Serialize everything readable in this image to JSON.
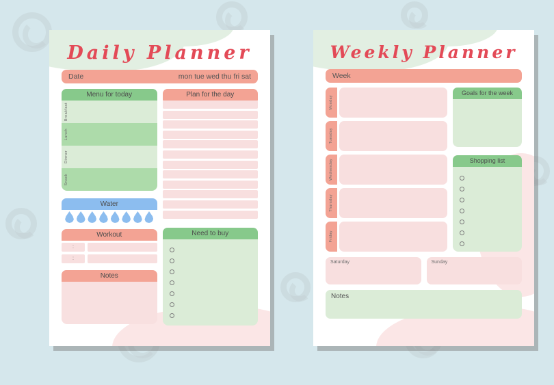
{
  "canvas": {
    "background_color": "#d5e7ec",
    "sheet_color": "#ffffff"
  },
  "palette": {
    "salmon": "#f3a394",
    "green": "#87c98b",
    "green_light": "#dbecd7",
    "green_mid": "#addbaa",
    "pink_light": "#f8e0e0",
    "blue": "#8cbdef",
    "title_red": "#e34a57"
  },
  "daily": {
    "title": "Daily Planner",
    "date_bar": {
      "label": "Date",
      "days": "mon tue wed thu fri sat"
    },
    "menu": {
      "header": "Menu for today",
      "rows": [
        {
          "label": "Breakfast"
        },
        {
          "label": "Lunch"
        },
        {
          "label": "Dinner"
        },
        {
          "label": "Snack"
        }
      ]
    },
    "plan": {
      "header": "Plan for the day",
      "line_count": 12
    },
    "water": {
      "header": "Water",
      "drop_count": 8
    },
    "workout": {
      "header": "Workout",
      "rows": [
        {
          "time": ":",
          "activity": ""
        },
        {
          "time": ":",
          "activity": ""
        }
      ]
    },
    "need_to_buy": {
      "header": "Need to buy",
      "item_count": 7
    },
    "notes": {
      "header": "Notes"
    }
  },
  "weekly": {
    "title": "Weekly Planner",
    "week_bar": {
      "label": "Week"
    },
    "days": [
      {
        "label": "Monday"
      },
      {
        "label": "Tuesday"
      },
      {
        "label": "Wednesday"
      },
      {
        "label": "Thursday"
      },
      {
        "label": "Friday"
      }
    ],
    "goals": {
      "header": "Goals for the week"
    },
    "shopping": {
      "header": "Shopping list",
      "item_count": 7
    },
    "weekend": [
      {
        "label": "Saturday"
      },
      {
        "label": "Sunday"
      }
    ],
    "notes": {
      "label": "Notes"
    }
  }
}
